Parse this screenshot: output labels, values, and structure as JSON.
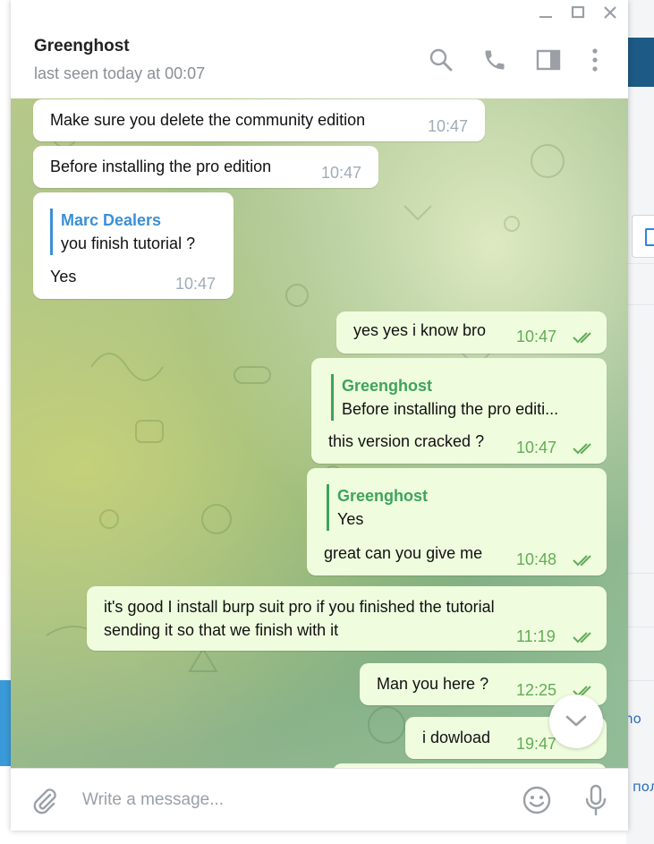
{
  "header": {
    "name": "Greenghost",
    "status": "last seen today at 00:07"
  },
  "messages": [
    {
      "dir": "in",
      "text": "Make sure you delete the community edition",
      "time": "10:47"
    },
    {
      "dir": "in",
      "text": "Before installing the pro edition",
      "time": "10:47"
    },
    {
      "dir": "in",
      "reply_name": "Marc Dealers",
      "reply_text": "you finish tutorial ?",
      "text": "Yes",
      "time": "10:47"
    },
    {
      "dir": "out",
      "text": "yes yes i know bro",
      "time": "10:47"
    },
    {
      "dir": "out",
      "reply_name": "Greenghost",
      "reply_text": "Before installing the pro editi...",
      "text": "this version cracked ?",
      "time": "10:47"
    },
    {
      "dir": "out",
      "reply_name": "Greenghost",
      "reply_text": "Yes",
      "text": "great can you give me",
      "time": "10:48"
    },
    {
      "dir": "out",
      "text_line1": "it's good I install burp suit pro if you finished the tutorial",
      "text_line2": "sending it so that we finish with it",
      "time": "11:19"
    },
    {
      "dir": "out",
      "text": "Man you here ?",
      "time": "12:25"
    },
    {
      "dir": "out",
      "text": "i dowload",
      "time": "19:47"
    }
  ],
  "composer": {
    "placeholder": "Write a message..."
  },
  "background_app": {
    "text_1": "n (ho",
    "text_2": "пол"
  },
  "colors": {
    "outgoing_bubble": "#effdde",
    "incoming_bubble": "#ffffff",
    "outgoing_time": "#62ac55",
    "reply_incoming_accent": "#3b8fd6",
    "reply_outgoing_accent": "#3fa35b",
    "icon_gray": "#9aa0a6"
  },
  "icons": [
    "minimize-icon",
    "maximize-icon",
    "close-icon",
    "search-icon",
    "phone-icon",
    "side-panel-icon",
    "more-vertical-icon",
    "double-check-icon",
    "chevron-down-icon",
    "paperclip-icon",
    "emoji-icon",
    "microphone-icon"
  ]
}
